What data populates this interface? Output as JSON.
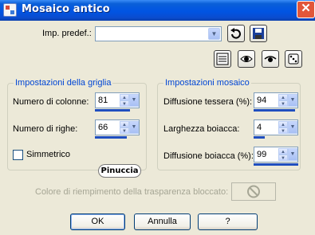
{
  "window": {
    "title": "Mosaico antico"
  },
  "preset": {
    "label": "Imp. predef.:",
    "value": ""
  },
  "grid_group": {
    "title": "Impostazioni della griglia",
    "columns": {
      "label": "Numero di colonne:",
      "value": "81"
    },
    "rows": {
      "label": "Numero di righe:",
      "value": "66"
    },
    "symmetric": {
      "label": "Simmetrico",
      "checked": false
    }
  },
  "mosaic_group": {
    "title": "Impostazioni mosaico",
    "tile_diffusion": {
      "label": "Diffusione tessera (%):",
      "value": "94"
    },
    "grout_width": {
      "label": "Larghezza boiacca:",
      "value": "4"
    },
    "grout_diffusion": {
      "label": "Diffusione boiacca (%):",
      "value": "99"
    }
  },
  "fill_color": {
    "label": "Colore di riempimento della trasparenza bloccato:",
    "disabled": true
  },
  "watermark": "Pinuccia",
  "buttons": {
    "ok": "OK",
    "cancel": "Annulla",
    "help": "?"
  },
  "icons": [
    "close-icon",
    "reset-icon",
    "save-icon",
    "preview-icon",
    "eye-icon",
    "dice-icon",
    "no-color-icon"
  ]
}
